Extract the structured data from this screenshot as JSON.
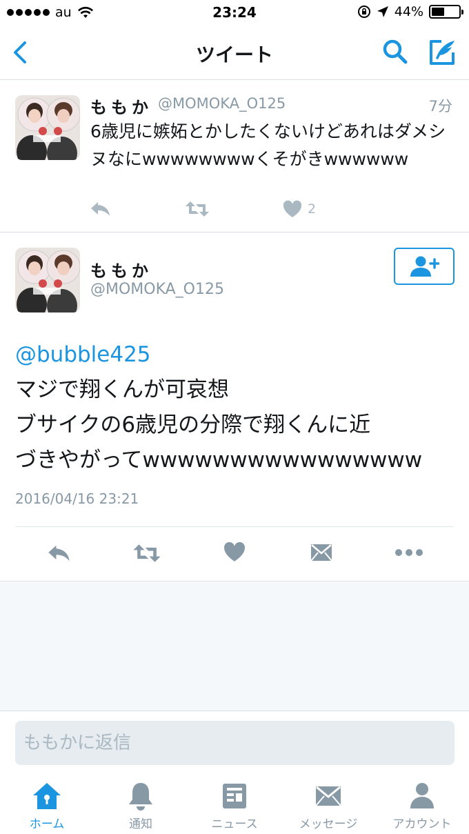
{
  "status_bar": {
    "carrier": "au",
    "time": "23:24",
    "battery": "44%",
    "battery_level": 0.44
  },
  "nav": {
    "title": "ツイート",
    "back_icon": "chevron-left-icon",
    "search_icon": "search-icon",
    "compose_icon": "compose-icon"
  },
  "tweet_1": {
    "display_name": "ももか",
    "handle": "@MOMOKA_O125",
    "time": "7分",
    "text": "6歳児に嫉妬とかしたくないけどあれはダメシヌなにwwwwwwwwくそがきwwwwww",
    "like_count": "2"
  },
  "main_tweet": {
    "display_name": "ももか",
    "handle": "@MOMOKA_O125",
    "mention": "@bubble425",
    "line_1": "マジで翔くんが可哀想",
    "line_2": "ブサイクの6歳児の分際で翔くんに近",
    "line_3": "づきやがってwwwwwwwwwwwwwwww",
    "timestamp": "2016/04/16 23:21"
  },
  "reply": {
    "placeholder": "ももかに返信"
  },
  "tabs": [
    {
      "label": "ホーム",
      "icon": "home-icon",
      "active": true
    },
    {
      "label": "通知",
      "icon": "bell-icon",
      "active": false
    },
    {
      "label": "ニュース",
      "icon": "news-icon",
      "active": false
    },
    {
      "label": "メッセージ",
      "icon": "envelope-icon",
      "active": false
    },
    {
      "label": "アカウント",
      "icon": "person-icon",
      "active": false
    }
  ],
  "colors": {
    "accent": "#1b95e0",
    "muted": "#8899a6",
    "icon_gray": "#aab8c2",
    "divider": "#d8dde1",
    "background_empty": "#f5f8fa"
  }
}
